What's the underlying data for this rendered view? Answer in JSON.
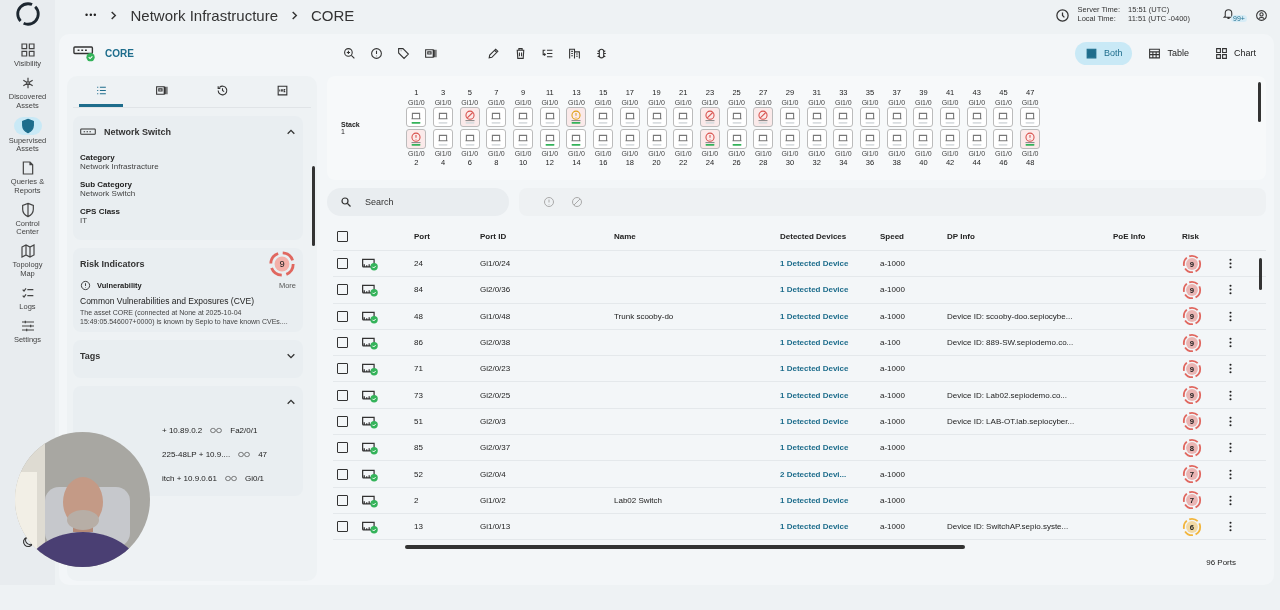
{
  "nav": [
    {
      "label": "Visibility",
      "selected": false
    },
    {
      "label": "Discovered Assets",
      "selected": false
    },
    {
      "label": "Supervised Assets",
      "selected": true
    },
    {
      "label": "Queries & Reports",
      "selected": false
    },
    {
      "label": "Control Center",
      "selected": false
    },
    {
      "label": "Topology Map",
      "selected": false
    },
    {
      "label": "Logs",
      "selected": false
    },
    {
      "label": "Settings",
      "selected": false
    }
  ],
  "breadcrumb": {
    "more": "•••",
    "items": [
      "Network Infrastructure",
      "CORE"
    ]
  },
  "clock": {
    "server_label": "Server Time:",
    "server_value": "15:51 (UTC)",
    "local_label": "Local Time:",
    "local_value": "11:51 (UTC -0400)"
  },
  "notifications": {
    "badge": "99+"
  },
  "asset": {
    "name": "CORE"
  },
  "views": [
    {
      "label": "Both",
      "selected": true
    },
    {
      "label": "Table",
      "selected": false
    },
    {
      "label": "Chart",
      "selected": false
    }
  ],
  "panel_tabs": [
    {
      "selected": true
    },
    {
      "selected": false
    },
    {
      "selected": false
    },
    {
      "selected": false
    }
  ],
  "device_section": {
    "title": "Network Switch",
    "expanded": true,
    "fields": [
      {
        "label": "Category",
        "value": "Network Infrastracture"
      },
      {
        "label": "Sub Category",
        "value": "Network Switch"
      },
      {
        "label": "CPS Class",
        "value": "IT"
      }
    ]
  },
  "risk_indicators": {
    "title": "Risk Indicators",
    "score": "9",
    "color": "#e0675f",
    "item": {
      "type": "Vulnerability",
      "more": "More",
      "title": "Common Vulnerabilities and Exposures (CVE)",
      "text": "The asset CORE (connected at None at 2025-10-04 15:49:05.546007+0000) is known by Sepio to have known CVEs...."
    }
  },
  "tags_section": {
    "title": "Tags",
    "expanded": false
  },
  "connections_section": {
    "expanded": true,
    "rows": [
      {
        "device": "+ 10.89.0.2",
        "port": "Fa2/0/1"
      },
      {
        "device": "225-48LP + 10.9....",
        "port": "47"
      },
      {
        "device": "itch + 10.9.0.61",
        "port": "Gi0/1"
      }
    ]
  },
  "stack": {
    "label": "Stack",
    "number": "1"
  },
  "ports_top": [
    {
      "number": "1",
      "label": "Gi1/0",
      "kind": "ok",
      "link": true
    },
    {
      "number": "3",
      "label": "Gi1/0",
      "kind": "ok",
      "link": false
    },
    {
      "number": "5",
      "label": "Gi1/0",
      "kind": "blocked",
      "link": false
    },
    {
      "number": "7",
      "label": "Gi1/0",
      "kind": "ok",
      "link": false
    },
    {
      "number": "9",
      "label": "Gi1/0",
      "kind": "ok",
      "link": false
    },
    {
      "number": "11",
      "label": "Gi1/0",
      "kind": "ok",
      "link": false
    },
    {
      "number": "13",
      "label": "Gi1/0",
      "kind": "warning",
      "link": true
    },
    {
      "number": "15",
      "label": "Gi1/0",
      "kind": "ok",
      "link": false
    },
    {
      "number": "17",
      "label": "Gi1/0",
      "kind": "ok",
      "link": false
    },
    {
      "number": "19",
      "label": "Gi1/0",
      "kind": "ok",
      "link": false
    },
    {
      "number": "21",
      "label": "Gi1/0",
      "kind": "ok",
      "link": false
    },
    {
      "number": "23",
      "label": "Gi1/0",
      "kind": "blocked",
      "link": false
    },
    {
      "number": "25",
      "label": "Gi1/0",
      "kind": "ok",
      "link": false
    },
    {
      "number": "27",
      "label": "Gi1/0",
      "kind": "blocked",
      "link": false
    },
    {
      "number": "29",
      "label": "Gi1/0",
      "kind": "ok",
      "link": false
    },
    {
      "number": "31",
      "label": "Gi1/0",
      "kind": "ok",
      "link": false
    },
    {
      "number": "33",
      "label": "Gi1/0",
      "kind": "ok",
      "link": false
    },
    {
      "number": "35",
      "label": "Gi1/0",
      "kind": "ok",
      "link": false
    },
    {
      "number": "37",
      "label": "Gi1/0",
      "kind": "ok",
      "link": false
    },
    {
      "number": "39",
      "label": "Gi1/0",
      "kind": "ok",
      "link": false
    },
    {
      "number": "41",
      "label": "Gi1/0",
      "kind": "ok",
      "link": false
    },
    {
      "number": "43",
      "label": "Gi1/0",
      "kind": "ok",
      "link": false
    },
    {
      "number": "45",
      "label": "Gi1/0",
      "kind": "ok",
      "link": false
    },
    {
      "number": "47",
      "label": "Gi1/0",
      "kind": "ok",
      "link": false
    }
  ],
  "ports_bottom": [
    {
      "number": "2",
      "label": "Gi1/0",
      "kind": "alert",
      "link": true
    },
    {
      "number": "4",
      "label": "Gi1/0",
      "kind": "ok",
      "link": false
    },
    {
      "number": "6",
      "label": "Gi1/0",
      "kind": "ok",
      "link": false
    },
    {
      "number": "8",
      "label": "Gi1/0",
      "kind": "ok",
      "link": false
    },
    {
      "number": "10",
      "label": "Gi1/0",
      "kind": "ok",
      "link": false
    },
    {
      "number": "12",
      "label": "Gi1/0",
      "kind": "ok",
      "link": true
    },
    {
      "number": "14",
      "label": "Gi1/0",
      "kind": "ok",
      "link": true
    },
    {
      "number": "16",
      "label": "Gi1/0",
      "kind": "ok",
      "link": false
    },
    {
      "number": "18",
      "label": "Gi1/0",
      "kind": "ok",
      "link": false
    },
    {
      "number": "20",
      "label": "Gi1/0",
      "kind": "ok",
      "link": false
    },
    {
      "number": "22",
      "label": "Gi1/0",
      "kind": "ok",
      "link": false
    },
    {
      "number": "24",
      "label": "Gi1/0",
      "kind": "alert",
      "link": true
    },
    {
      "number": "26",
      "label": "Gi1/0",
      "kind": "ok",
      "link": true
    },
    {
      "number": "28",
      "label": "Gi1/0",
      "kind": "ok",
      "link": false
    },
    {
      "number": "30",
      "label": "Gi1/0",
      "kind": "ok",
      "link": false
    },
    {
      "number": "32",
      "label": "Gi1/0",
      "kind": "ok",
      "link": false
    },
    {
      "number": "34",
      "label": "Gi1/0",
      "kind": "ok",
      "link": false
    },
    {
      "number": "36",
      "label": "Gi1/0",
      "kind": "ok",
      "link": false
    },
    {
      "number": "38",
      "label": "Gi1/0",
      "kind": "ok",
      "link": false
    },
    {
      "number": "40",
      "label": "Gi1/0",
      "kind": "ok",
      "link": false
    },
    {
      "number": "42",
      "label": "Gi1/0",
      "kind": "ok",
      "link": false
    },
    {
      "number": "44",
      "label": "Gi1/0",
      "kind": "ok",
      "link": false
    },
    {
      "number": "46",
      "label": "Gi1/0",
      "kind": "ok",
      "link": false
    },
    {
      "number": "48",
      "label": "Gi1/0",
      "kind": "alert",
      "link": true
    }
  ],
  "search": {
    "placeholder": "Search"
  },
  "select_all": {
    "checked": false
  },
  "columns": [
    "Port",
    "Port ID",
    "Name",
    "Detected Devices",
    "Speed",
    "DP Info",
    "PoE Info",
    "Risk"
  ],
  "rows": [
    {
      "checked": false,
      "port": "24",
      "port_id": "Gi1/0/24",
      "name": "",
      "detected": "1 Detected Device",
      "speed": "a-1000",
      "dp_info": "",
      "risk": "9",
      "color": "#e0675f"
    },
    {
      "checked": false,
      "port": "84",
      "port_id": "Gi2/0/36",
      "name": "",
      "detected": "1 Detected Device",
      "speed": "a-1000",
      "dp_info": "",
      "risk": "9",
      "color": "#e0675f"
    },
    {
      "checked": false,
      "port": "48",
      "port_id": "Gi1/0/48",
      "name": "Trunk scooby-do",
      "detected": "1 Detected Device",
      "speed": "a-1000",
      "dp_info": "Device ID: scooby-doo.sepiocybe...",
      "risk": "9",
      "color": "#e0675f"
    },
    {
      "checked": false,
      "port": "86",
      "port_id": "Gi2/0/38",
      "name": "",
      "detected": "1 Detected Device",
      "speed": "a-100",
      "dp_info": "Device ID: 889-SW.sepiodemo.co...",
      "risk": "9",
      "color": "#e0675f"
    },
    {
      "checked": false,
      "port": "71",
      "port_id": "Gi2/0/23",
      "name": "",
      "detected": "1 Detected Device",
      "speed": "a-1000",
      "dp_info": "",
      "risk": "9",
      "color": "#e0675f"
    },
    {
      "checked": false,
      "port": "73",
      "port_id": "Gi2/0/25",
      "name": "",
      "detected": "1 Detected Device",
      "speed": "a-1000",
      "dp_info": "Device ID: Lab02.sepiodemo.co...",
      "risk": "9",
      "color": "#e0675f"
    },
    {
      "checked": false,
      "port": "51",
      "port_id": "Gi2/0/3",
      "name": "",
      "detected": "1 Detected Device",
      "speed": "a-1000",
      "dp_info": "Device ID: LAB-OT.lab.sepiocyber...",
      "risk": "9",
      "color": "#e0675f"
    },
    {
      "checked": false,
      "port": "85",
      "port_id": "Gi2/0/37",
      "name": "",
      "detected": "1 Detected Device",
      "speed": "a-1000",
      "dp_info": "",
      "risk": "8",
      "color": "#e0675f"
    },
    {
      "checked": false,
      "port": "52",
      "port_id": "Gi2/0/4",
      "name": "",
      "detected": "2 Detected Devi...",
      "speed": "a-1000",
      "dp_info": "",
      "risk": "7",
      "color": "#e0675f"
    },
    {
      "checked": false,
      "port": "2",
      "port_id": "Gi1/0/2",
      "name": "Lab02 Switch",
      "detected": "1 Detected Device",
      "speed": "a-1000",
      "dp_info": "",
      "risk": "7",
      "color": "#e0675f"
    },
    {
      "checked": false,
      "port": "13",
      "port_id": "Gi1/0/13",
      "name": "",
      "detected": "1 Detected Device",
      "speed": "a-1000",
      "dp_info": "Device ID: SwitchAP.sepio.syste...",
      "risk": "6",
      "color": "#f2b53c"
    }
  ],
  "footer": {
    "count": "96 Ports"
  }
}
